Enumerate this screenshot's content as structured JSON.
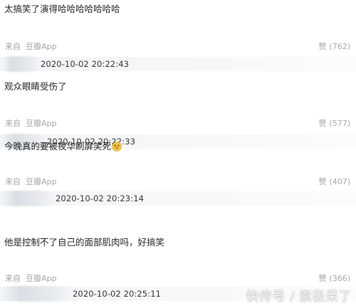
{
  "comments": [
    {
      "text": "太搞笑了演得哈哈哈哈哈哈哈",
      "source_label": "来自",
      "source_app": "豆瓣App",
      "likes_label": "赞",
      "likes_count": "(762)",
      "timestamp": "2020-10-02 20:22:43"
    },
    {
      "text": "观众眼睛受伤了",
      "source_label": "来自",
      "source_app": "豆瓣App",
      "likes_label": "赞",
      "likes_count": "(577)",
      "timestamp": "2020-10-02 20:22:33"
    },
    {
      "text": "今晚真的要被夜华刷屏笑死",
      "source_label": "来自",
      "source_app": "豆瓣App",
      "likes_label": "赞",
      "likes_count": "(407)",
      "timestamp": "2020-10-02 20:23:14"
    },
    {
      "text": "他是控制不了自己的面部肌肉吗，好搞笑",
      "source_label": "来自",
      "source_app": "豆瓣App",
      "likes_label": "赞",
      "likes_count": "(366)",
      "timestamp": "2020-10-02 20:25:11"
    }
  ],
  "watermark": "快传号 / 素极采了",
  "colors": {
    "meta_gray": "#a6a6a6",
    "text_dark": "#1f1f1f",
    "time_bar": "#f2f4f6",
    "emoji_yellow": "#f7c948"
  },
  "icons": {
    "laughing_emoji": "laughing-face-emoji"
  }
}
